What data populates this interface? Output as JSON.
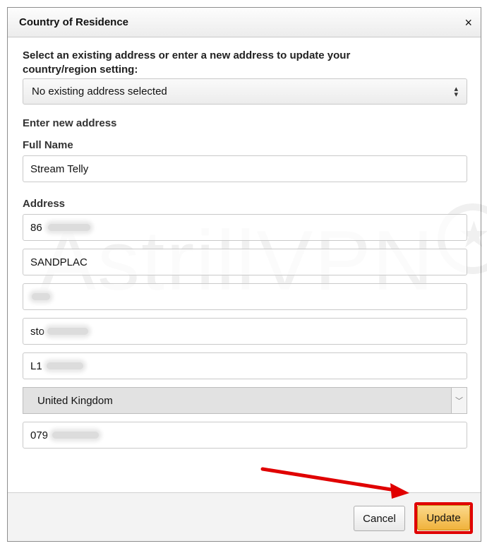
{
  "dialog": {
    "title": "Country of Residence",
    "close_glyph": "×"
  },
  "form": {
    "prompt": "Select an existing address or enter a new address to update your country/region setting:",
    "existing_select": {
      "selected": "No existing address selected"
    },
    "new_address_heading": "Enter new address",
    "full_name_label": "Full Name",
    "full_name_value": "Stream Telly",
    "address_label": "Address",
    "address_lines": {
      "line1": "86",
      "line2": "SANDPLAC",
      "line3": "",
      "line4": "sto",
      "line5": "L1"
    },
    "country_select": {
      "selected": "United Kingdom"
    },
    "phone_value": "079"
  },
  "watermark": {
    "text": "AstrillVPN"
  },
  "footer": {
    "cancel_label": "Cancel",
    "update_label": "Update"
  },
  "colors": {
    "highlight": "#e00000",
    "update_button": "#f0b23c"
  }
}
